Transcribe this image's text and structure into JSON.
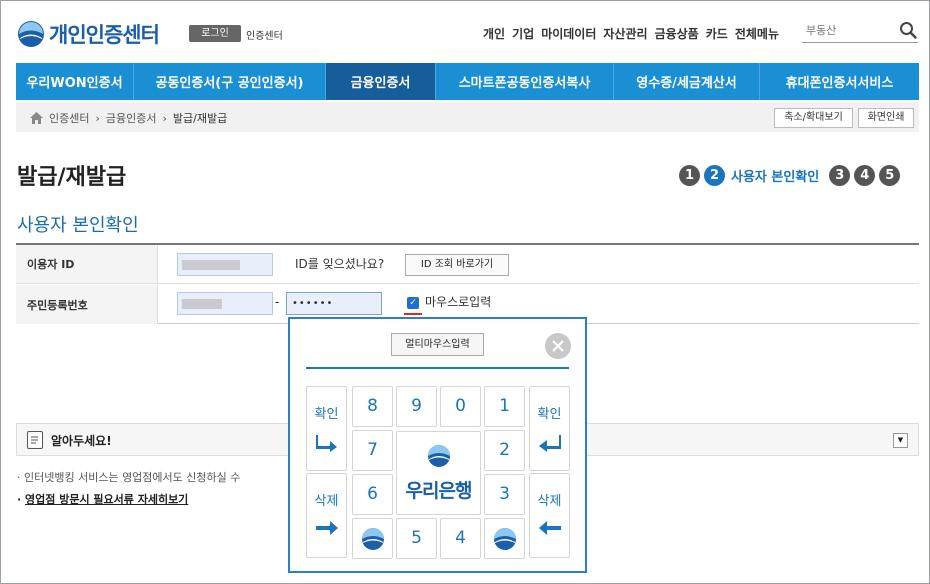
{
  "header": {
    "logo_text": "개인인증센터",
    "login_label": "로그인",
    "center_label": "인증센터",
    "top_menu": [
      "개인",
      "기업",
      "마이데이터",
      "자산관리",
      "금융상품",
      "카드",
      "전체메뉴"
    ],
    "search_placeholder": "부동산"
  },
  "nav": {
    "items": [
      "우리WON인증서",
      "공동인증서(구 공인인증서)",
      "금융인증서",
      "스마트폰공동인증서복사",
      "영수증/세금계산서",
      "휴대폰인증서서비스"
    ],
    "active_index": 2
  },
  "breadcrumb": {
    "items": [
      "인증센터",
      "금융인증서",
      "발급/재발급"
    ],
    "zoom_button": "축소/확대보기",
    "print_button": "화면인쇄"
  },
  "page": {
    "title": "발급/재발급",
    "section_title": "사용자 본인확인",
    "steps": [
      "1",
      "2",
      "3",
      "4",
      "5"
    ],
    "active_step": "2",
    "active_step_label": "사용자 본인확인"
  },
  "form": {
    "user_id_label": "이용자 ID",
    "lost_id_text": "ID를 잊으셨나요?",
    "id_lookup_button": "ID 조회 바로가기",
    "rrn_label": "주민등록번호",
    "rrn_separator": "-",
    "rrn_back_masked": "••••••",
    "mouse_input_label": "마우스로입력",
    "mouse_input_checked": true
  },
  "notice": {
    "title": "알아두세요!",
    "bullet1": "· 인터넷뱅킹 서비스는 영업점에서도 신청하실 수",
    "bullet2": "영업점 방문시 필요서류 자세히보기"
  },
  "keypad": {
    "multi_button": "멀티마우스입력",
    "confirm": "확인",
    "delete": "삭제",
    "bank_name": "우리은행",
    "keys": {
      "r1": [
        "8",
        "9",
        "0",
        "1"
      ],
      "r2": [
        "7",
        "2"
      ],
      "r3": [
        "6",
        "3"
      ],
      "r4": [
        "5",
        "4"
      ]
    }
  },
  "colors": {
    "nav_bg": "#1a8fd4",
    "nav_active": "#155e9b",
    "brand_blue": "#1a75bd",
    "checkbox_underline": "#e0281e"
  }
}
